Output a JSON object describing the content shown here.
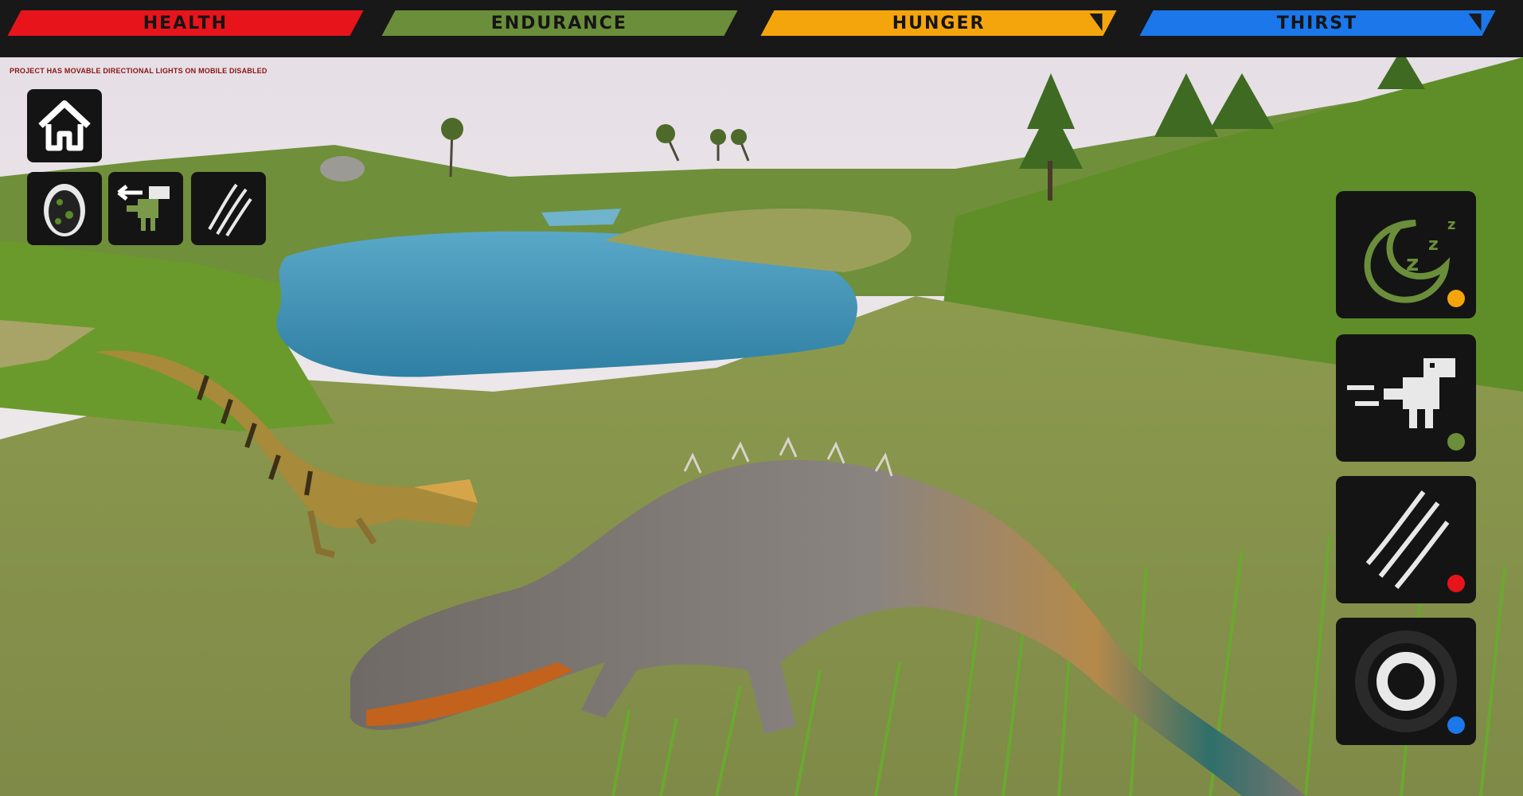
{
  "stats": {
    "health": {
      "label": "HEALTH",
      "color": "#e8141b"
    },
    "endurance": {
      "label": "ENDURANCE",
      "color": "#6b8e3a"
    },
    "hunger": {
      "label": "HUNGER",
      "color": "#f5a50c"
    },
    "thirst": {
      "label": "THIRST",
      "color": "#1b77ea"
    }
  },
  "notice": "PROJECT HAS MOVABLE DIRECTIONAL LIGHTS ON MOBILE DISABLED",
  "left_buttons": {
    "home": {
      "icon": "home-icon"
    },
    "egg": {
      "icon": "egg-icon"
    },
    "switch_dino": {
      "icon": "dino-switch-icon"
    },
    "attack": {
      "icon": "claw-icon"
    }
  },
  "right_buttons": [
    {
      "icon": "sleep-icon",
      "indicator_color": "#f5a50c"
    },
    {
      "icon": "run-dino-icon",
      "indicator_color": "#6b8e3a"
    },
    {
      "icon": "claw-attack-icon",
      "indicator_color": "#e8141b"
    },
    {
      "icon": "target-icon",
      "indicator_color": "#1b77ea"
    }
  ]
}
